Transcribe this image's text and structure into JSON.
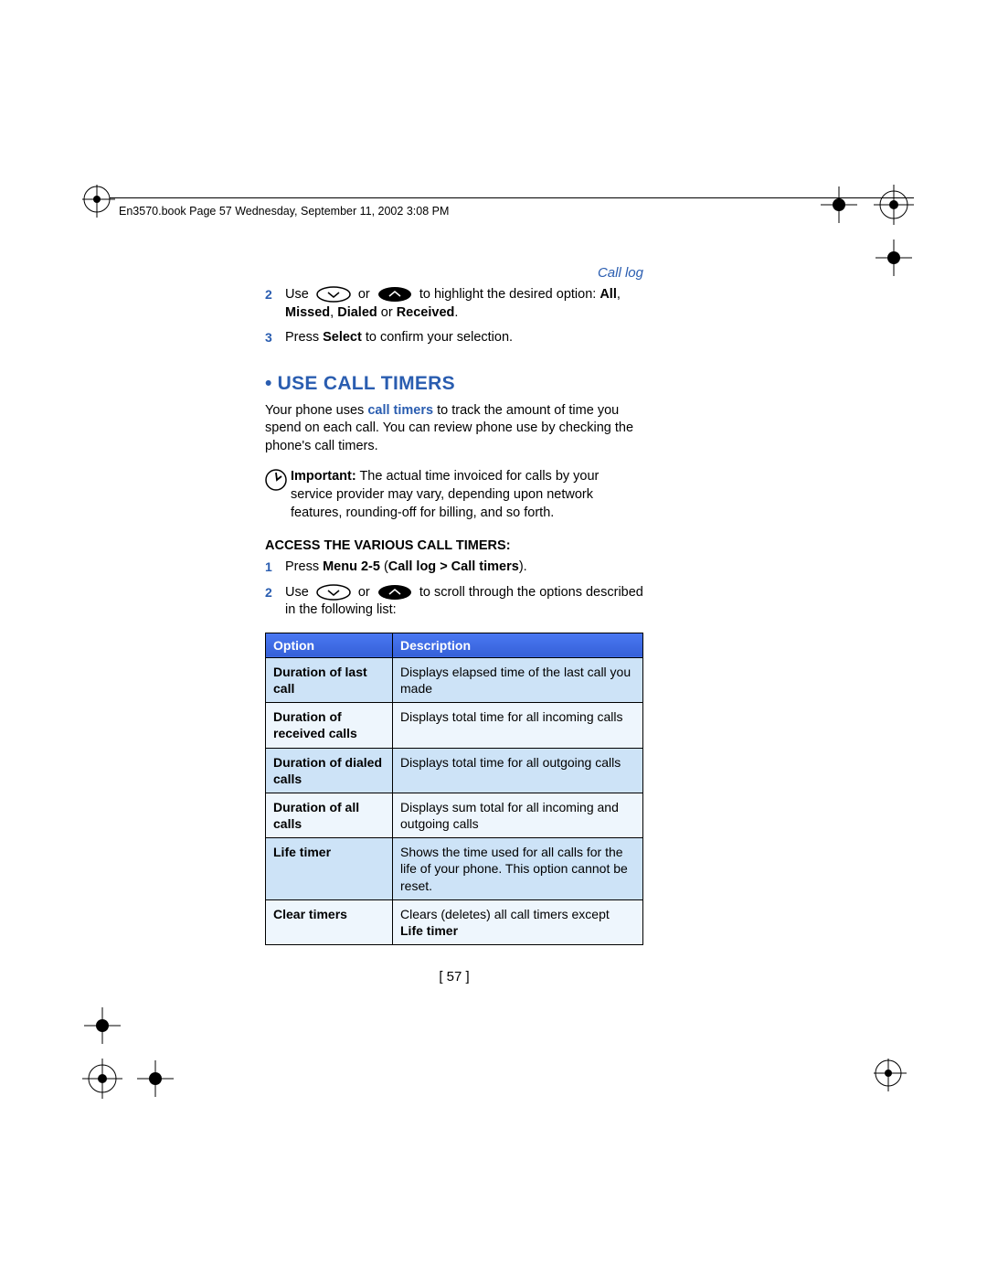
{
  "header": {
    "text": "En3570.book  Page 57  Wednesday, September 11, 2002  3:08 PM"
  },
  "section_header": "Call log",
  "steps_top": {
    "s2": {
      "num": "2",
      "pre": "Use",
      "mid": "or",
      "post": "to highlight the desired option: ",
      "bold1": "All",
      "comma1": ", ",
      "bold2": "Missed",
      "comma2": ", ",
      "bold3": "Dialed",
      "or": " or ",
      "bold4": "Received",
      "end": "."
    },
    "s3": {
      "num": "3",
      "pre": "Press ",
      "bold": "Select",
      "post": " to confirm your selection."
    }
  },
  "heading": "USE CALL TIMERS",
  "intro": {
    "pre": "Your phone uses ",
    "link": "call timers",
    "post": " to track the amount of time you spend on each call. You can review phone use by checking the phone's call timers."
  },
  "important": {
    "label": "Important:",
    "text": " The actual time invoiced for calls by your service provider may vary, depending upon network features, rounding-off for billing, and so forth."
  },
  "subheading": "ACCESS THE VARIOUS CALL TIMERS:",
  "steps_mid": {
    "s1": {
      "num": "1",
      "pre": "Press ",
      "bold": "Menu 2-5",
      "paren": " (",
      "bold2": "Call log > Call timers",
      "end": ")."
    },
    "s2": {
      "num": "2",
      "pre": "Use",
      "mid": "or",
      "post": "to scroll through the options described in the following list:"
    }
  },
  "table": {
    "head": {
      "c1": "Option",
      "c2": "Description"
    },
    "rows": [
      {
        "opt": "Duration of last call",
        "desc": "Displays elapsed time of the last call you made"
      },
      {
        "opt": "Duration of received calls",
        "desc": "Displays total time for all incoming calls"
      },
      {
        "opt": "Duration of dialed calls",
        "desc": "Displays total time for all outgoing calls"
      },
      {
        "opt": "Duration of all calls",
        "desc": "Displays sum total for all incoming and outgoing calls"
      },
      {
        "opt": "Life timer",
        "desc": "Shows the time used for all calls for the life of your phone. This option cannot be reset."
      },
      {
        "opt": "Clear timers",
        "desc_pre": "Clears (deletes) all call timers except ",
        "desc_bold": "Life timer"
      }
    ]
  },
  "page_number": "[ 57 ]"
}
